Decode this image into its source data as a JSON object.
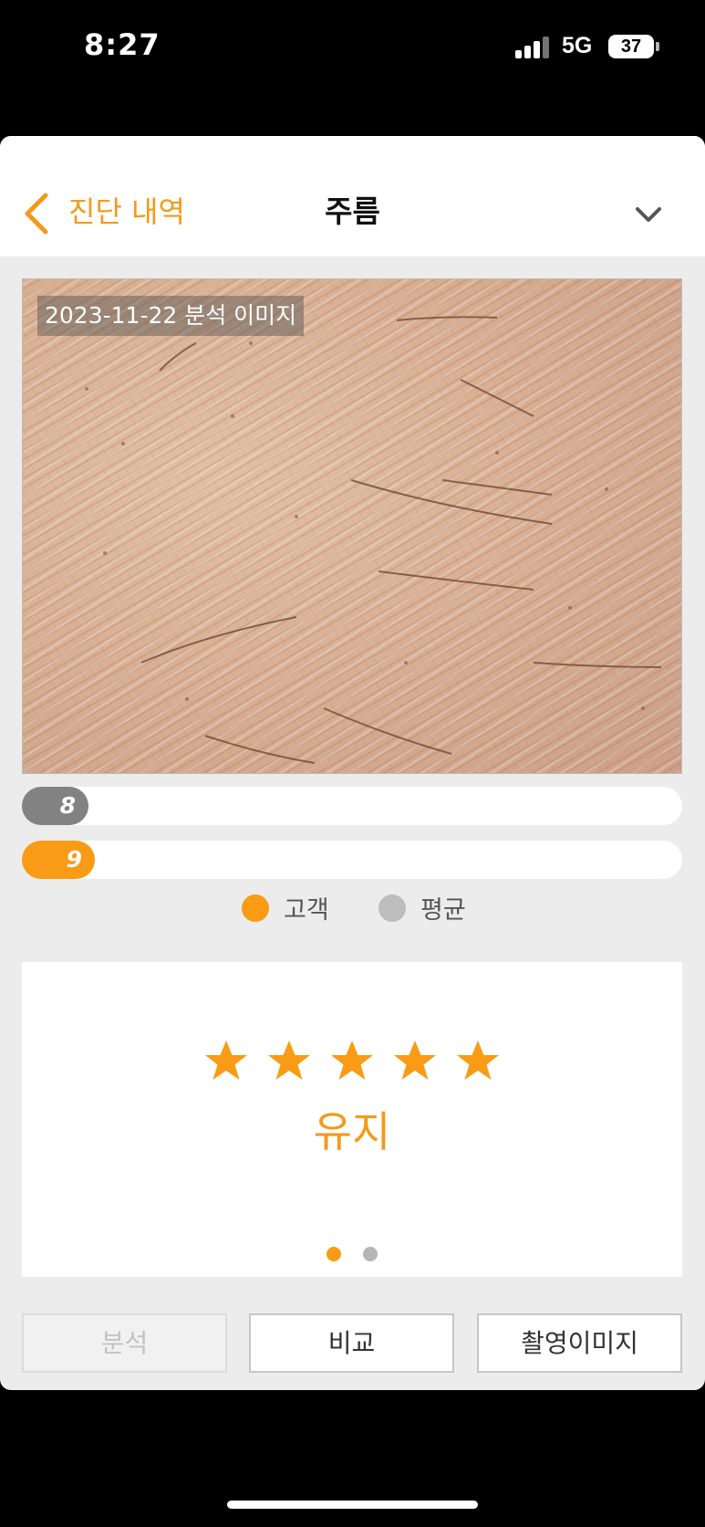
{
  "status_bar": {
    "time": "8:27",
    "network": "5G",
    "battery": "37"
  },
  "nav": {
    "back_label": "진단 내역",
    "title": "주름"
  },
  "photo": {
    "caption": "2023-11-22 분석 이미지"
  },
  "comparison": {
    "average_score": "8",
    "customer_score": "9",
    "average_fill_fraction": 0.1,
    "customer_fill_fraction": 0.11
  },
  "legend": {
    "customer_label": "고객",
    "average_label": "평균"
  },
  "rating": {
    "stars": 5,
    "max_stars": 5,
    "grade_label": "유지"
  },
  "pager": {
    "pages": 2,
    "active_page": 1
  },
  "buttons": {
    "analysis": "분석",
    "compare": "비교",
    "captured_image": "촬영이미지"
  },
  "colors": {
    "accent": "#f39a1a",
    "customer_bar": "#f99b14",
    "average_bar": "#828282",
    "legend_average": "#bdbdbd"
  },
  "icons": {
    "back": "chevron-left-icon",
    "menu": "chevron-down-icon",
    "star": "star-icon"
  }
}
